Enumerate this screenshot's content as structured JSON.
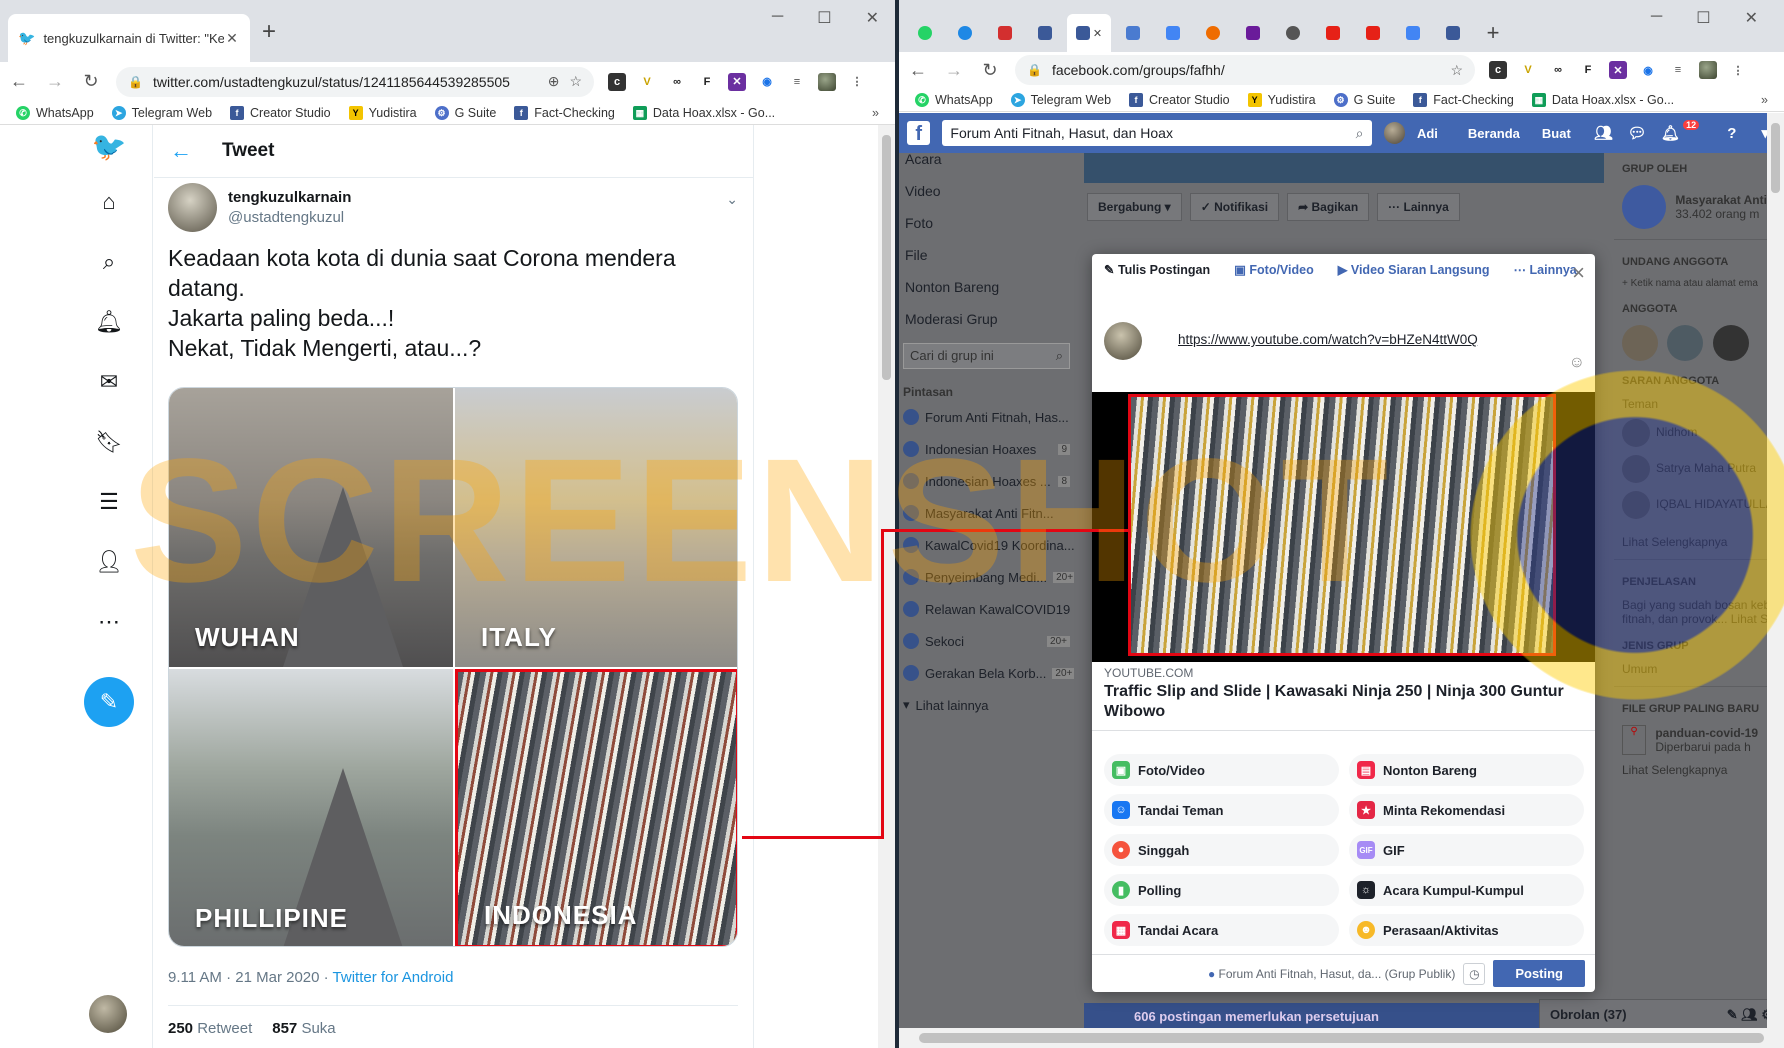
{
  "left_window": {
    "tab_title": "tengkuzulkarnain di Twitter: \"Kea",
    "url": "twitter.com/ustadtengkuzul/status/1241185644539285505",
    "bookmarks": [
      "WhatsApp",
      "Telegram Web",
      "Creator Studio",
      "Yudistira",
      "G Suite",
      "Fact-Checking",
      "Data Hoax.xlsx - Go..."
    ]
  },
  "twitter": {
    "header_title": "Tweet",
    "user_name": "tengkuzulkarnain",
    "user_handle": "@ustadtengkuzul",
    "tweet_lines": [
      "Keadaan kota kota di dunia saat Corona mendera",
      "datang.",
      "Jakarta paling beda...!",
      "Nekat, Tidak Mengerti, atau...?"
    ],
    "image_labels": [
      "WUHAN",
      "ITALY",
      "PHILLIPINE",
      "INDONESIA"
    ],
    "timestamp": "9.11 AM · 21 Mar 2020 · ",
    "source": "Twitter for Android",
    "retweets": "250",
    "retweets_label": "Retweet",
    "likes": "857",
    "likes_label": "Suka"
  },
  "right_window": {
    "url": "facebook.com/groups/fafhh/",
    "bookmarks": [
      "WhatsApp",
      "Telegram Web",
      "Creator Studio",
      "Yudistira",
      "G Suite",
      "Fact-Checking",
      "Data Hoax.xlsx - Go..."
    ]
  },
  "facebook": {
    "search_value": "Forum Anti Fitnah, Hasut, dan Hoax",
    "user": "Adi",
    "nav_home": "Beranda",
    "nav_create": "Buat",
    "notif_count": "12",
    "left_nav": [
      "Acara",
      "Video",
      "Foto",
      "File",
      "Nonton Bareng",
      "Moderasi Grup"
    ],
    "group_search_placeholder": "Cari di grup ini",
    "shortcuts_header": "Pintasan",
    "shortcuts": [
      {
        "name": "Forum Anti Fitnah, Has...",
        "count": ""
      },
      {
        "name": "Indonesian Hoaxes",
        "count": "9"
      },
      {
        "name": "Indonesian Hoaxes ...",
        "count": "8"
      },
      {
        "name": "Masyarakat Anti Fitn...",
        "count": ""
      },
      {
        "name": "KawalCovid19 Koordina...",
        "count": ""
      },
      {
        "name": "Penyeimbang Medi...",
        "count": "20+"
      },
      {
        "name": "Relawan KawalCOVID19",
        "count": ""
      },
      {
        "name": "Sekoci",
        "count": "20+"
      },
      {
        "name": "Gerakan Bela Korb...",
        "count": "20+"
      }
    ],
    "see_more": "Lihat lainnya",
    "group_buttons": [
      "Bergabung ▾",
      "✓ Notifikasi",
      "➦ Bagikan",
      "··· Lainnya"
    ],
    "right_sidebar": {
      "group_by": "GRUP OLEH",
      "org_name": "Masyarakat Anti",
      "org_members": "33.402 orang m",
      "invite_header": "UNDANG ANGGOTA",
      "invite_placeholder": "+ Ketik nama atau alamat ema",
      "members_header": "ANGGOTA",
      "new_members_header": "SARAN ANGGOTA",
      "friends_label": "Teman",
      "members": [
        "Nidhom",
        "Satrya Maha Putra",
        "IQBAL HIDAYATULLA"
      ],
      "see_more": "Lihat Selengkapnya",
      "desc_header": "PENJELASAN",
      "desc_text": "Bagi yang sudah bosan keb fitnah, dan provok... Lihat S",
      "type_header": "JENIS GRUP",
      "type_value": "Umum",
      "files_header": "FILE GRUP PALING BARU",
      "file_name": "panduan-covid-19",
      "file_updated": "Diperbarui pada h",
      "see_more2": "Lihat Selengkapnya"
    },
    "pending_notice": "606 postingan memerlukan persetujuan",
    "chat_label": "Obrolan (37)"
  },
  "composer": {
    "tabs": [
      "Tulis Postingan",
      "Foto/Video",
      "Video Siaran Langsung",
      "Lainnya"
    ],
    "url_text": "https://www.youtube.com/watch?v=bHZeN4ttW0Q",
    "link_source": "YOUTUBE.COM",
    "link_title": "Traffic Slip and Slide | Kawasaki Ninja 250 | Ninja 300 Guntur Wibowo",
    "options": [
      {
        "label": "Foto/Video",
        "icon": "photo-icon",
        "color": "#45bd62"
      },
      {
        "label": "Nonton Bareng",
        "icon": "popcorn-icon",
        "color": "#f02849"
      },
      {
        "label": "Tandai Teman",
        "icon": "tag-friend-icon",
        "color": "#1877f2"
      },
      {
        "label": "Minta Rekomendasi",
        "icon": "star-icon",
        "color": "#e42645"
      },
      {
        "label": "Singgah",
        "icon": "checkin-icon",
        "color": "#f5533d"
      },
      {
        "label": "GIF",
        "icon": "gif-icon",
        "color": "#a68bf5"
      },
      {
        "label": "Polling",
        "icon": "poll-icon",
        "color": "#45bd62"
      },
      {
        "label": "Acara Kumpul-Kumpul",
        "icon": "event-icon",
        "color": "#1d2129"
      },
      {
        "label": "Tandai Acara",
        "icon": "calendar-icon",
        "color": "#f02849"
      },
      {
        "label": "Perasaan/Aktivitas",
        "icon": "feeling-icon",
        "color": "#f7b928"
      }
    ],
    "audience": "Forum Anti Fitnah, Hasut, da...",
    "audience_type": "(Grup Publik)",
    "post_button": "Posting"
  },
  "watermark": "SCREENSHOT",
  "colors": {
    "twitter_blue": "#1da1f2",
    "facebook_blue": "#4267b2",
    "highlight_red": "#e30613"
  }
}
